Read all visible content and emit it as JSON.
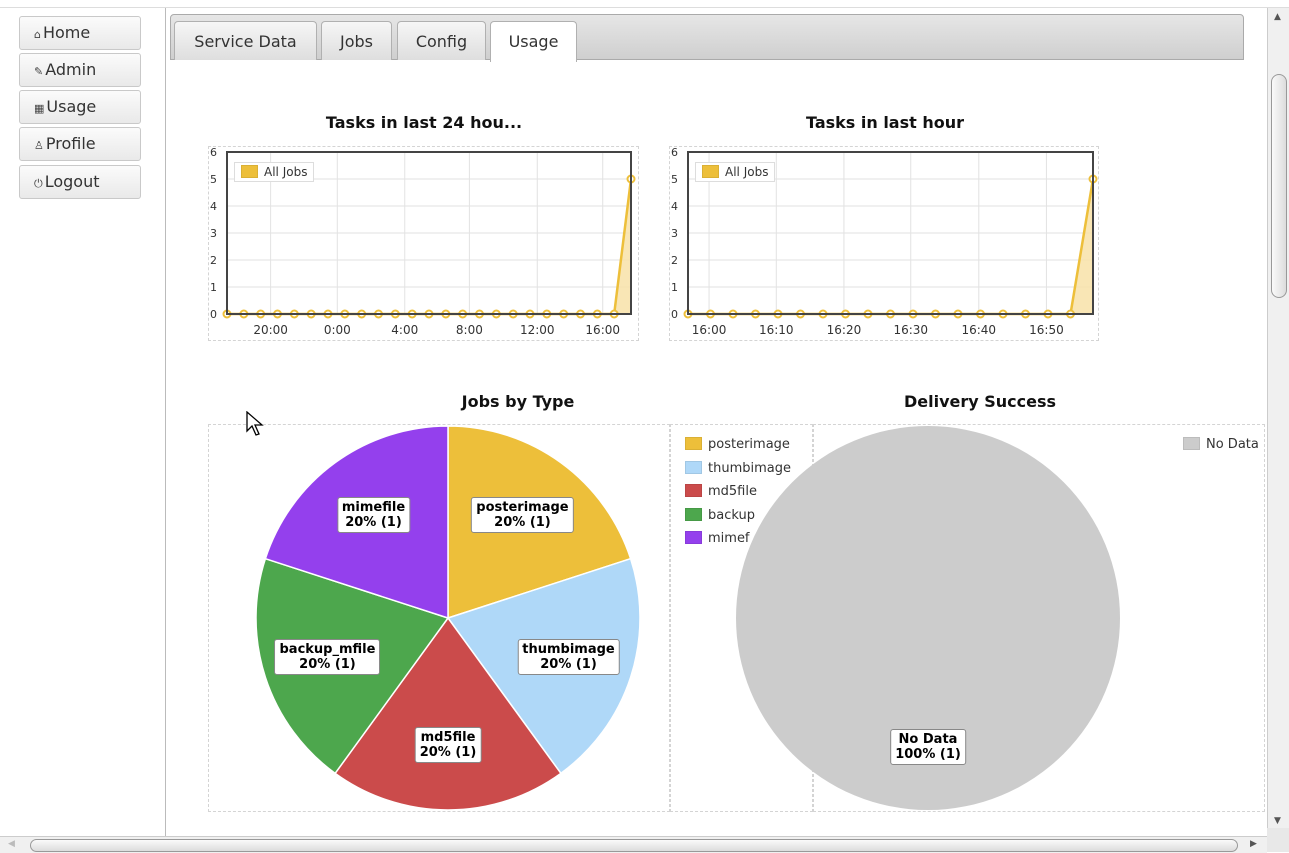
{
  "nav": [
    {
      "icon": "home-icon",
      "glyph": "⌂",
      "label": "Home"
    },
    {
      "icon": "wrench-icon",
      "glyph": "✎",
      "label": "Admin"
    },
    {
      "icon": "grid-icon",
      "glyph": "▦",
      "label": "Usage"
    },
    {
      "icon": "user-icon",
      "glyph": "♙",
      "label": "Profile"
    },
    {
      "icon": "power-icon",
      "glyph": "⏻",
      "label": "Logout"
    }
  ],
  "tabs": [
    "Service Data",
    "Jobs",
    "Config",
    "Usage"
  ],
  "active_tab": "Usage",
  "colors": {
    "line": "#edbf3a",
    "fill": "#f8e2a8",
    "posterimage": "#edbf3a",
    "thumbimage": "#afd8f8",
    "md5file": "#cb4b4b",
    "backup": "#4da74d",
    "mimefile": "#9440ed",
    "nodata": "#cccccc"
  },
  "chart_data": [
    {
      "type": "area",
      "title": "Tasks in last 24 hou...",
      "legend": [
        "All Jobs"
      ],
      "xticks": [
        "20:00",
        "0:00",
        "4:00",
        "8:00",
        "12:00",
        "16:00"
      ],
      "yticks": [
        "0",
        "1",
        "2",
        "3",
        "4",
        "5",
        "6"
      ],
      "ylim": [
        0,
        6
      ],
      "series": [
        {
          "name": "All Jobs",
          "values": [
            0,
            0,
            0,
            0,
            0,
            0,
            0,
            0,
            0,
            0,
            0,
            0,
            0,
            0,
            0,
            0,
            0,
            0,
            0,
            0,
            0,
            0,
            0,
            0,
            5
          ]
        }
      ]
    },
    {
      "type": "area",
      "title": "Tasks in last hour",
      "legend": [
        "All Jobs"
      ],
      "xticks": [
        "16:00",
        "16:10",
        "16:20",
        "16:30",
        "16:40",
        "16:50"
      ],
      "yticks": [
        "0",
        "1",
        "2",
        "3",
        "4",
        "5",
        "6"
      ],
      "ylim": [
        0,
        6
      ],
      "series": [
        {
          "name": "All Jobs",
          "values": [
            0,
            0,
            0,
            0,
            0,
            0,
            0,
            0,
            0,
            0,
            0,
            0,
            0,
            0,
            0,
            0,
            0,
            0,
            5
          ]
        }
      ]
    },
    {
      "type": "pie",
      "title": "Jobs by Type",
      "slices": [
        {
          "name": "posterimage",
          "label": "posterimage",
          "value": 1,
          "pct": "20% (1)",
          "color": "#edbf3a"
        },
        {
          "name": "thumbimage",
          "label": "thumbimage",
          "value": 1,
          "pct": "20% (1)",
          "color": "#afd8f8"
        },
        {
          "name": "md5file",
          "label": "md5file",
          "value": 1,
          "pct": "20% (1)",
          "color": "#cb4b4b"
        },
        {
          "name": "backup",
          "label": "backup_mfile",
          "value": 1,
          "pct": "20% (1)",
          "color": "#4da74d"
        },
        {
          "name": "mimefile",
          "label": "mimefile",
          "value": 1,
          "pct": "20% (1)",
          "color": "#9440ed"
        }
      ],
      "legend": [
        "posterimage",
        "thumbimage",
        "md5file",
        "backup",
        "mimef"
      ]
    },
    {
      "type": "pie",
      "title": "Delivery Success",
      "slices": [
        {
          "name": "No Data",
          "label": "No Data",
          "value": 1,
          "pct": "100% (1)",
          "color": "#cccccc"
        }
      ],
      "legend": [
        "No Data"
      ]
    }
  ]
}
